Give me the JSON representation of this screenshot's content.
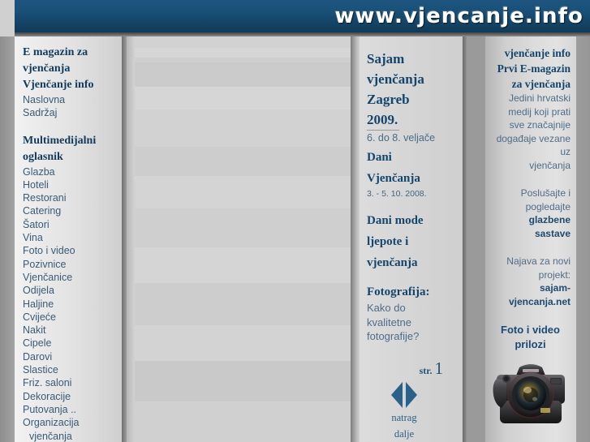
{
  "header": {
    "site_title": "www.vjencanje.info"
  },
  "sidebar": {
    "heading_1_line_1": "E magazin za",
    "heading_1_line_2": "vjenčanja",
    "heading_1_line_3": "Vjenčanje info",
    "top_items": [
      {
        "label": "Naslovna"
      },
      {
        "label": "Sadržaj"
      }
    ],
    "heading_2_line_1": "Multimedijalni",
    "heading_2_line_2": "oglasnik",
    "items": [
      {
        "label": "Glazba"
      },
      {
        "label": "Hoteli"
      },
      {
        "label": "Restorani"
      },
      {
        "label": "Catering"
      },
      {
        "label": "Šatori"
      },
      {
        "label": "Vina"
      },
      {
        "label": "Foto i video"
      },
      {
        "label": "Pozivnice"
      },
      {
        "label": "Vjenčanice"
      },
      {
        "label": "Odijela"
      },
      {
        "label": "Haljine"
      },
      {
        "label": "Cvijeće"
      },
      {
        "label": "Nakit"
      },
      {
        "label": "Cipele"
      },
      {
        "label": "Darovi"
      },
      {
        "label": "Slastice"
      },
      {
        "label": "Friz. saloni"
      },
      {
        "label": "Dekoracije"
      },
      {
        "label": "Putovanja .."
      },
      {
        "label": "Organizacija"
      },
      {
        "label": "vjenčanja"
      }
    ]
  },
  "center": {
    "fair_title_line_1": "Sajam",
    "fair_title_line_2": "vjenčanja",
    "fair_title_line_3": "Zagreb",
    "fair_title_line_4": "2009.",
    "fair_dates": "6. do 8. veljače",
    "days_title_line_1": "Dani",
    "days_title_line_2": "Vjenčanja",
    "days_dates": "3. - 5. 10. 2008.",
    "fashion_line_1": "Dani mode",
    "fashion_line_2": "ljepote i",
    "fashion_line_3": "vjenčanja",
    "photo_heading": "Fotografija:",
    "photo_body_line_1": "Kako do",
    "photo_body_line_2": "kvalitetne",
    "photo_body_line_3": "fotografije?",
    "page_label": "str.",
    "page_number": "1",
    "prev_label": "natrag",
    "next_label": "dalje"
  },
  "right": {
    "head_line_1": "vjenčanje info",
    "head_line_2": "Prvi E-magazin",
    "head_line_3": "za vjenčanja",
    "intro_line_1": "Jedini hrvatski",
    "intro_line_2": "medij koji prati",
    "intro_line_3": "sve značajnije",
    "intro_line_4": "događaje vezane uz",
    "intro_line_5": "vjenčanja",
    "music_line_1": "Poslušajte i",
    "music_line_2": "pogledajte",
    "music_line_3": "glazbene",
    "music_line_4": "sastave",
    "project_line_1": "Najava za novi",
    "project_line_2": "projekt:",
    "project_line_3": "sajam-",
    "project_line_4": "vjencanja.net",
    "media_title": "Foto i video prilozi",
    "camera_alt": "dslr-camera-photo",
    "camera_caption": ""
  },
  "colors": {
    "header_blue": "#14456b",
    "link_blue": "#3a5b77",
    "heading_blue": "#14456b",
    "page_gray": "#d4d4d4"
  }
}
